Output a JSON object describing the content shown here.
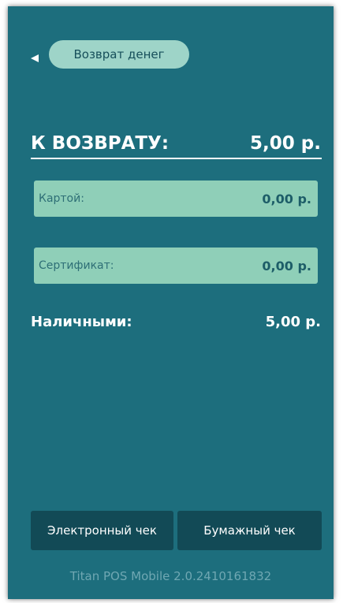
{
  "header": {
    "back_label": "Возврат денег"
  },
  "total": {
    "label": "К ВОЗВРАТУ:",
    "value": "5,00 р."
  },
  "payments": {
    "card": {
      "label": "Картой:",
      "value": "0,00 р."
    },
    "certificate": {
      "label": "Сертификат:",
      "value": "0,00 р."
    }
  },
  "cash": {
    "label": "Наличными:",
    "value": "5,00 р."
  },
  "buttons": {
    "electronic_receipt": "Электронный чек",
    "paper_receipt": "Бумажный чек"
  },
  "footer": {
    "version": "Titan POS Mobile 2.0.2410161832"
  },
  "colors": {
    "background": "#1d6e7d",
    "pill": "#9ed4c8",
    "field": "#8fcfb8",
    "button": "#124a56"
  }
}
